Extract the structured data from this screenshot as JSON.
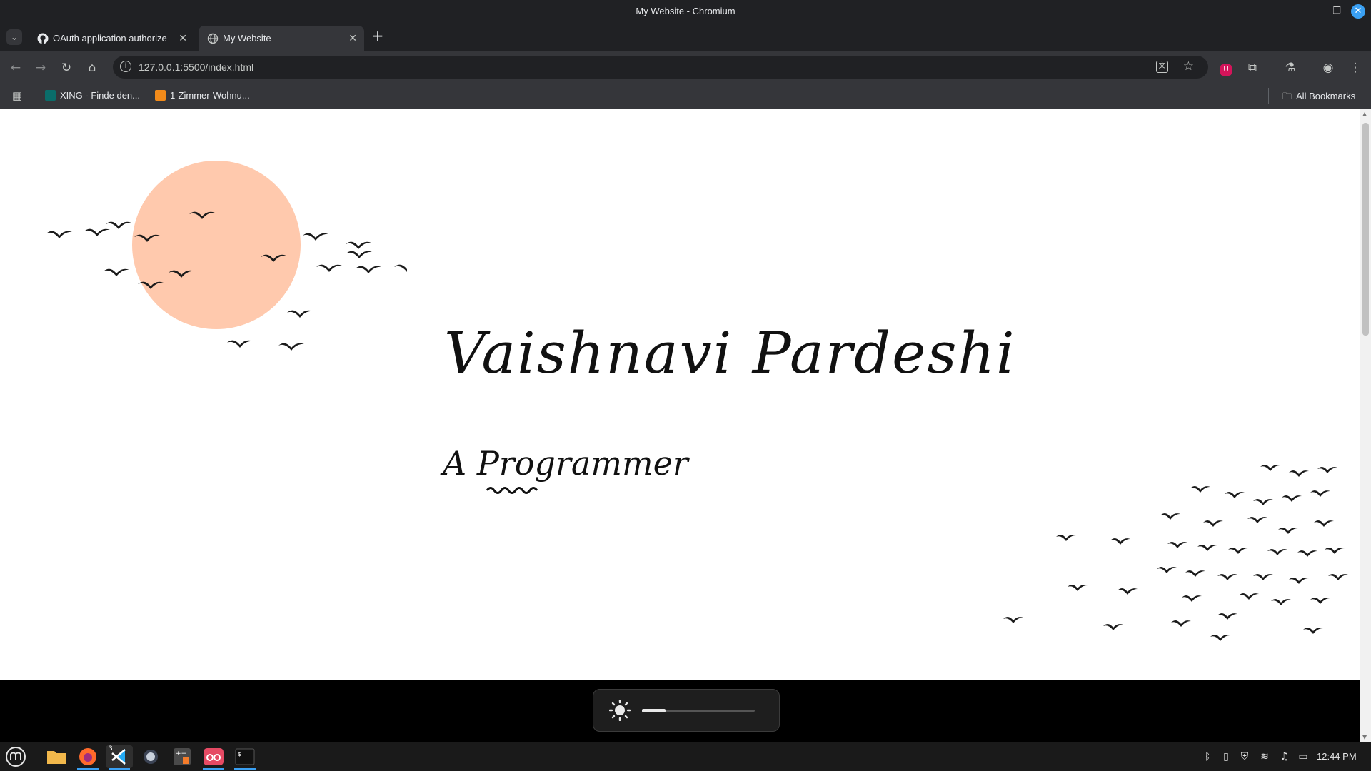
{
  "window": {
    "title": "My Website - Chromium"
  },
  "tabs": [
    {
      "label": "OAuth application authorize",
      "icon": "github-icon",
      "active": false
    },
    {
      "label": "My Website",
      "icon": "globe-icon",
      "active": true
    }
  ],
  "toolbar": {
    "url": "127.0.0.1:5500/index.html"
  },
  "bookmarks": {
    "items": [
      {
        "label": "XING - Finde den...",
        "icon": "xing-icon"
      },
      {
        "label": "1-Zimmer-Wohnu...",
        "icon": "wg-icon"
      }
    ],
    "all_label": "All Bookmarks"
  },
  "page": {
    "name": "Vaishnavi Pardeshi",
    "subtitle": "A Programmer"
  },
  "brightness": {
    "level": 0.21
  },
  "taskbar": {
    "clock": "12:44 PM",
    "vscode_badge": "3"
  },
  "colors": {
    "sun": "#ffc9ad",
    "bird": "#1b1b1b",
    "accent": "#3aa0f3"
  }
}
